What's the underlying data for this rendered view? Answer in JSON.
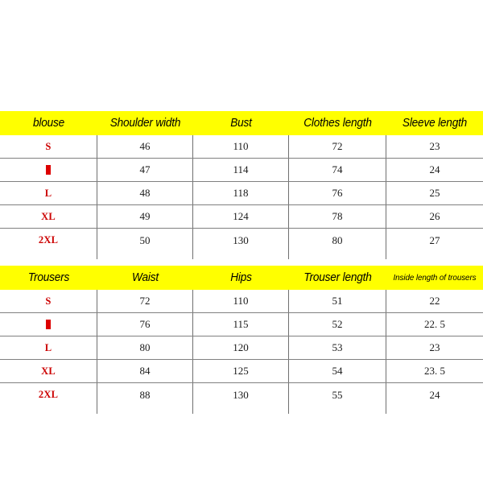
{
  "page": {
    "background": "#ffffff",
    "header_band_color": "#ffff00",
    "size_label_color": "#cc0000",
    "divider_color": "#707070",
    "value_color": "#1a1a1a"
  },
  "tables": [
    {
      "id": "blouse",
      "name": "blouse-size-table",
      "headers": [
        {
          "label": "blouse",
          "small": false
        },
        {
          "label": "Shoulder width",
          "small": false
        },
        {
          "label": "Bust",
          "small": false
        },
        {
          "label": "Clothes length",
          "small": false
        },
        {
          "label": "Sleeve length",
          "small": false
        }
      ],
      "rows": [
        {
          "size": "S",
          "tofu": false,
          "values": [
            "46",
            "110",
            "72",
            "23"
          ]
        },
        {
          "size": "M",
          "tofu": true,
          "values": [
            "47",
            "114",
            "74",
            "24"
          ]
        },
        {
          "size": "L",
          "tofu": false,
          "values": [
            "48",
            "118",
            "76",
            "25"
          ]
        },
        {
          "size": "XL",
          "tofu": false,
          "values": [
            "49",
            "124",
            "78",
            "26"
          ]
        },
        {
          "size": "2XL",
          "tofu": false,
          "values": [
            "50",
            "130",
            "80",
            "27"
          ]
        }
      ]
    },
    {
      "id": "trousers",
      "name": "trousers-size-table",
      "headers": [
        {
          "label": "Trousers",
          "small": false
        },
        {
          "label": "Waist",
          "small": false
        },
        {
          "label": "Hips",
          "small": false
        },
        {
          "label": "Trouser length",
          "small": false
        },
        {
          "label": "Inside length of trousers",
          "small": true
        }
      ],
      "rows": [
        {
          "size": "S",
          "tofu": false,
          "values": [
            "72",
            "110",
            "51",
            "22"
          ]
        },
        {
          "size": "M",
          "tofu": true,
          "values": [
            "76",
            "115",
            "52",
            "22. 5"
          ]
        },
        {
          "size": "L",
          "tofu": false,
          "values": [
            "80",
            "120",
            "53",
            "23"
          ]
        },
        {
          "size": "XL",
          "tofu": false,
          "values": [
            "84",
            "125",
            "54",
            "23. 5"
          ]
        },
        {
          "size": "2XL",
          "tofu": false,
          "values": [
            "88",
            "130",
            "55",
            "24"
          ]
        }
      ]
    }
  ]
}
